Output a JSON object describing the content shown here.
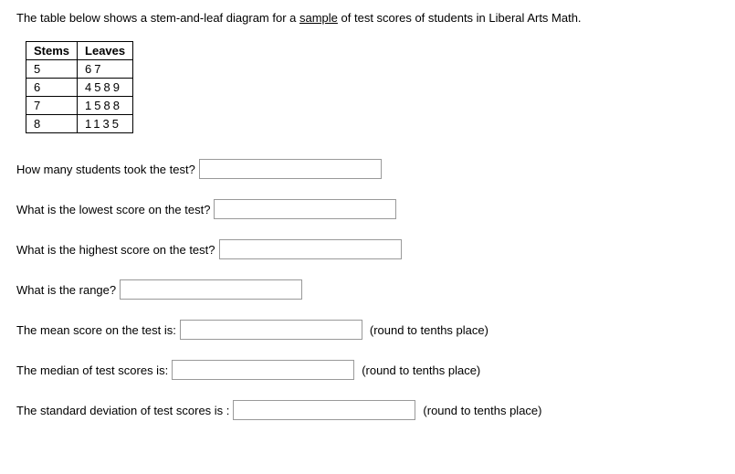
{
  "intro": {
    "pre": "The table below shows a stem-and-leaf diagram for a ",
    "underlined": "sample",
    "post": " of test scores of students in Liberal Arts Math."
  },
  "table": {
    "headers": {
      "stems": "Stems",
      "leaves": "Leaves"
    },
    "rows": [
      {
        "stem": "5",
        "leaves": "67"
      },
      {
        "stem": "6",
        "leaves": "4589"
      },
      {
        "stem": "7",
        "leaves": "1588"
      },
      {
        "stem": "8",
        "leaves": "1135"
      }
    ]
  },
  "questions": {
    "q1": {
      "label": "How many students took the test?"
    },
    "q2": {
      "label": "What is the lowest score on the test?"
    },
    "q3": {
      "label": "What is the highest score on the test?"
    },
    "q4": {
      "label": "What is the range?"
    },
    "q5": {
      "label": "The mean score on the test is:",
      "hint": "(round to tenths place)"
    },
    "q6": {
      "label": "The median of test scores is:",
      "hint": "(round to tenths place)"
    },
    "q7": {
      "label": "The standard deviation of test scores is :",
      "hint": "(round to tenths place)"
    }
  }
}
